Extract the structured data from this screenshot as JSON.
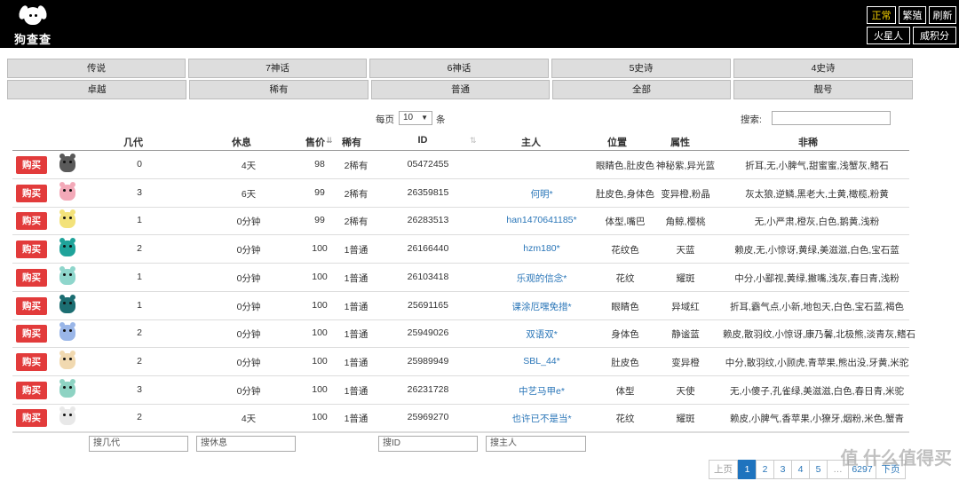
{
  "header": {
    "logo_text": "狗查查",
    "buttons": [
      {
        "label": "正常",
        "active": true
      },
      {
        "label": "繁殖",
        "active": false
      },
      {
        "label": "刷新",
        "active": false
      },
      {
        "label": "火星人",
        "active": false
      },
      {
        "label": "威积分",
        "active": false
      }
    ]
  },
  "categories_row1": [
    "传说",
    "7神话",
    "6神话",
    "5史诗",
    "4史诗"
  ],
  "categories_row2": [
    "卓越",
    "稀有",
    "普通",
    "全部",
    "靓号"
  ],
  "controls": {
    "per_page_label": "每页",
    "per_page_value": "10",
    "per_page_unit": "条",
    "search_label": "搜索:",
    "search_value": ""
  },
  "table": {
    "headers": [
      "几代",
      "休息",
      "售价",
      "稀有",
      "ID",
      "主人",
      "位置",
      "属性",
      "非稀"
    ],
    "buy_label": "购买",
    "rows": [
      {
        "gen": "0",
        "rest": "4天",
        "price": "98",
        "rarity": "2稀有",
        "id": "05472455",
        "owner": "",
        "pos": "眼睛色,肚皮色",
        "attr": "神秘紫,异光蓝",
        "traits": "折耳,无,小脾气,甜蜜蜜,浅蟹灰,鳍石",
        "pet_color": "#5a5a5a"
      },
      {
        "gen": "3",
        "rest": "6天",
        "price": "99",
        "rarity": "2稀有",
        "id": "26359815",
        "owner": "何明*",
        "pos": "肚皮色,身体色",
        "attr": "变异橙,粉晶",
        "traits": "灰太狼,逆鳞,黑老大,土黄,橄榄,粉黄",
        "pet_color": "#f3a9b8"
      },
      {
        "gen": "1",
        "rest": "0分钟",
        "price": "99",
        "rarity": "2稀有",
        "id": "26283513",
        "owner": "han1470641185*",
        "pos": "体型,嘴巴",
        "attr": "角鲸,樱桃",
        "traits": "无,小严肃,橙灰,白色,鹅黄,浅粉",
        "pet_color": "#f3e27a"
      },
      {
        "gen": "2",
        "rest": "0分钟",
        "price": "100",
        "rarity": "1普通",
        "id": "26166440",
        "owner": "hzm180*",
        "pos": "花纹色",
        "attr": "天蓝",
        "traits": "赖皮,无,小惊讶,黄绿,美滋滋,白色,宝石蓝",
        "pet_color": "#1fa39a"
      },
      {
        "gen": "1",
        "rest": "0分钟",
        "price": "100",
        "rarity": "1普通",
        "id": "26103418",
        "owner": "乐观的信念*",
        "pos": "花纹",
        "attr": "耀斑",
        "traits": "中分,小鄙视,黄绿,撇嘴,浅灰,春日青,浅粉",
        "pet_color": "#8fd6cc"
      },
      {
        "gen": "1",
        "rest": "0分钟",
        "price": "100",
        "rarity": "1普通",
        "id": "25691165",
        "owner": "课涂厄嘿免措*",
        "pos": "眼睛色",
        "attr": "异域红",
        "traits": "折耳,霸气点,小新,地包天,白色,宝石蓝,褐色",
        "pet_color": "#1c6e72"
      },
      {
        "gen": "2",
        "rest": "0分钟",
        "price": "100",
        "rarity": "1普通",
        "id": "25949026",
        "owner": "双语双*",
        "pos": "身体色",
        "attr": "静谧蓝",
        "traits": "赖皮,散羽纹,小惊讶,康乃馨,北极熊,淡青灰,鳍石",
        "pet_color": "#9ab6e8"
      },
      {
        "gen": "2",
        "rest": "0分钟",
        "price": "100",
        "rarity": "1普通",
        "id": "25989949",
        "owner": "SBL_44*",
        "pos": "肚皮色",
        "attr": "变异橙",
        "traits": "中分,散羽纹,小顾虎,青苹果,熊出没,牙黄,米驼",
        "pet_color": "#f1d9b0"
      },
      {
        "gen": "3",
        "rest": "0分钟",
        "price": "100",
        "rarity": "1普通",
        "id": "26231728",
        "owner": "中艺马甲e*",
        "pos": "体型",
        "attr": "天使",
        "traits": "无,小傻子,孔雀绿,美滋滋,白色,春日青,米驼",
        "pet_color": "#8ed3c3"
      },
      {
        "gen": "2",
        "rest": "4天",
        "price": "100",
        "rarity": "1普通",
        "id": "25969270",
        "owner": "也许已不是当*",
        "pos": "花纹",
        "attr": "耀斑",
        "traits": "赖皮,小脾气,香苹果,小獠牙,烟粉,米色,蟹青",
        "pet_color": "#e8e8e8"
      }
    ]
  },
  "footer_search": {
    "gen_placeholder": "搜几代",
    "rest_placeholder": "搜休息",
    "id_placeholder": "搜ID",
    "owner_placeholder": "搜主人"
  },
  "pagination": {
    "prev": "上页",
    "pages": [
      "1",
      "2",
      "3",
      "4",
      "5"
    ],
    "ellipsis": "…",
    "last": "6297",
    "next": "下页",
    "current": "1"
  },
  "watermark": "值 什么值得买"
}
